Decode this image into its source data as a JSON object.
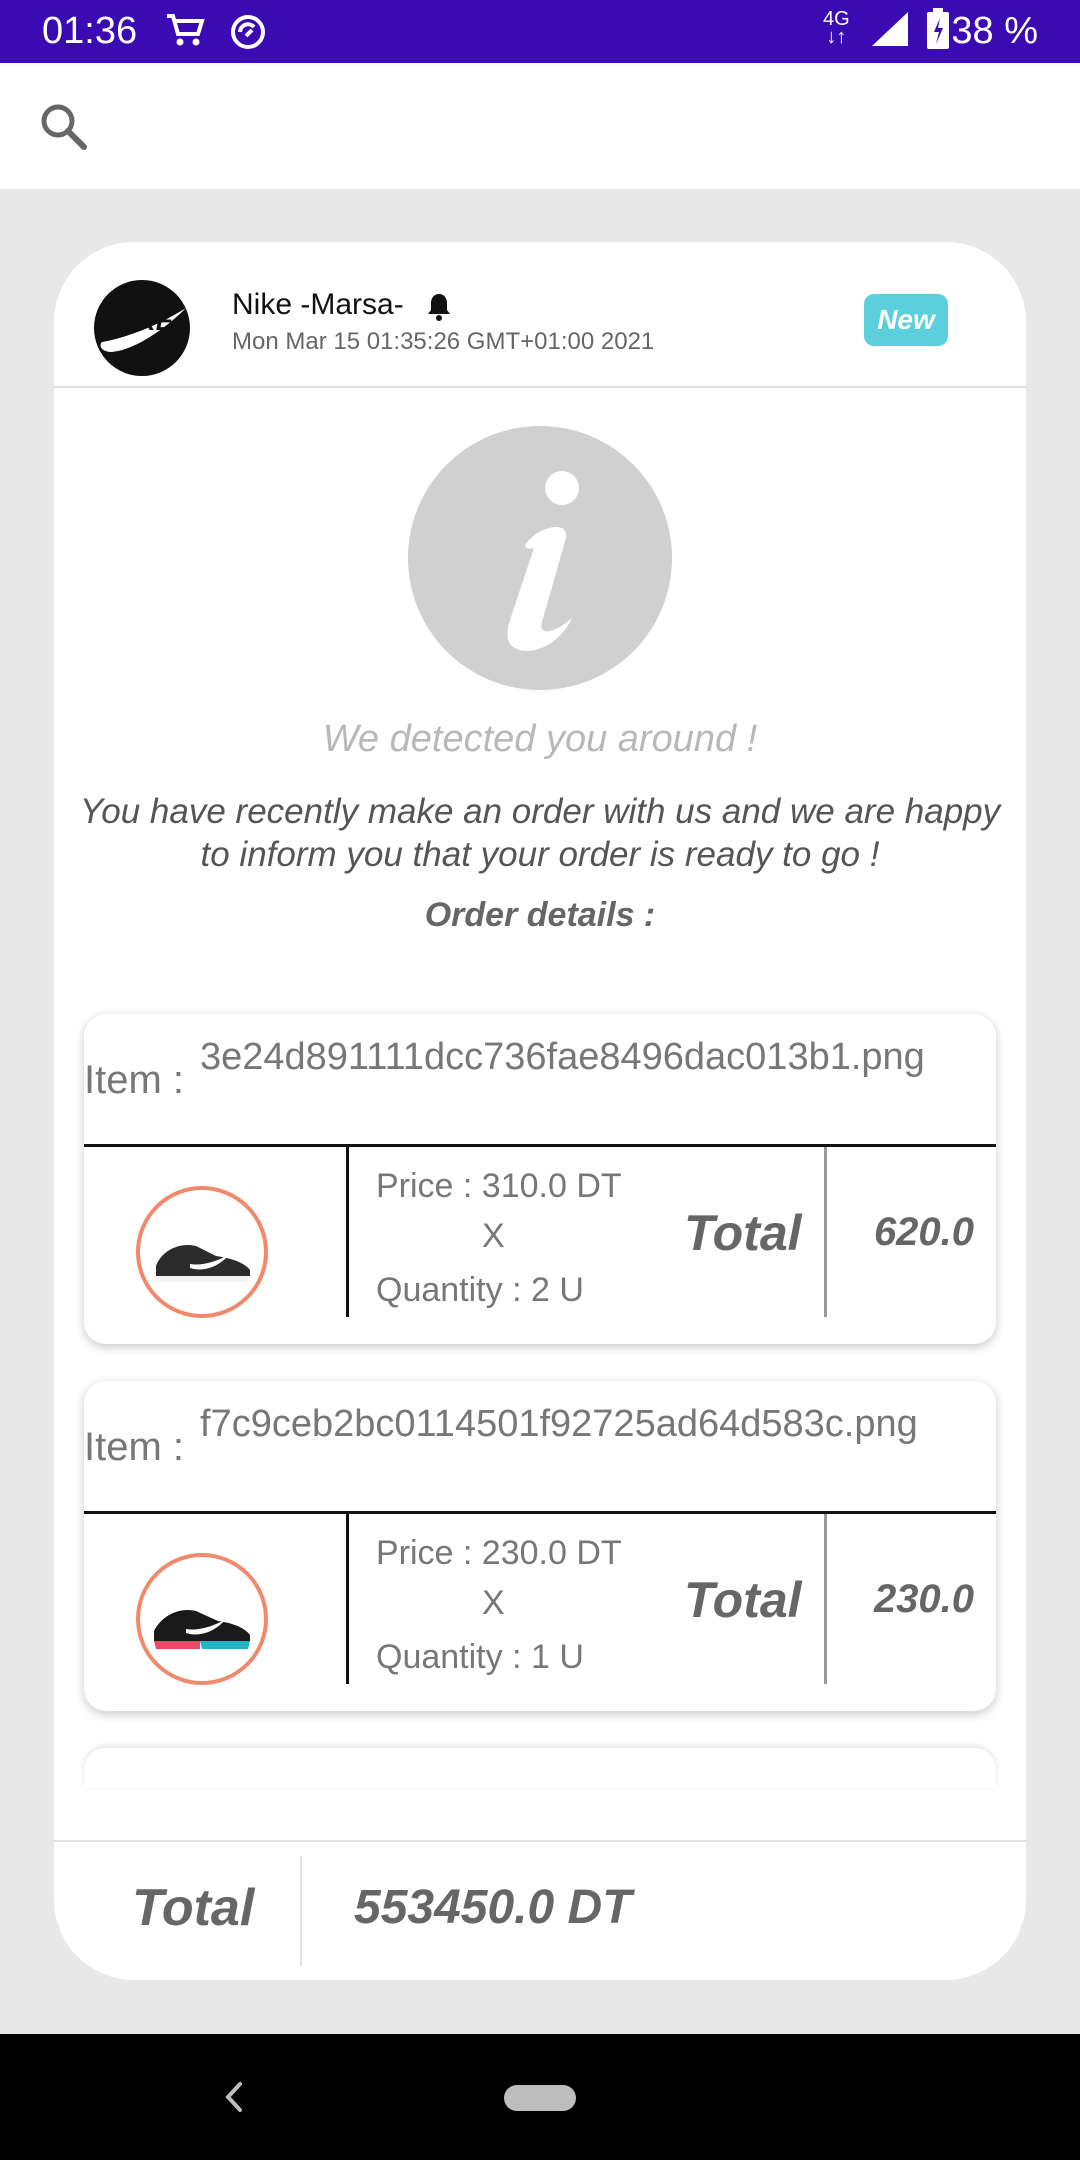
{
  "status_bar": {
    "time": "01:36",
    "network": "4G",
    "battery": "38 %"
  },
  "search": {
    "icon": "search-icon"
  },
  "notification": {
    "store_name": "Nike -Marsa-",
    "date": "Mon Mar 15 01:35:26 GMT+01:00 2021",
    "badge": "New",
    "detected_title": "We detected you around !",
    "message": "You have recently make an order with us and we are happy to inform you that your order is ready to go !",
    "order_details_label": "Order details :"
  },
  "items": [
    {
      "label": "Item :",
      "name": "3e24d891111dcc736fae8496dac013b1.png",
      "price": "Price : 310.0 DT",
      "times": "X",
      "quantity": "Quantity : 2 U",
      "total_label": "Total",
      "total": "620.0"
    },
    {
      "label": "Item :",
      "name": "f7c9ceb2bc0114501f92725ad64d583c.png",
      "price": "Price : 230.0 DT",
      "times": "X",
      "quantity": "Quantity : 1 U",
      "total_label": "Total",
      "total": "230.0"
    }
  ],
  "footer": {
    "total_label": "Total",
    "total_amount": "553450.0 DT"
  },
  "colors": {
    "status_bar": "#3a0ab3",
    "badge": "#5bd0dc",
    "thumb_ring": "#f08a6c"
  }
}
